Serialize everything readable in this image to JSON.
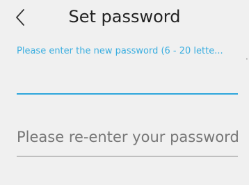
{
  "header": {
    "title": "Set password",
    "back_icon": "chevron-left-icon"
  },
  "new_password": {
    "hint": "Please enter the new password (6 - 20 lette...",
    "value": ""
  },
  "confirm_password": {
    "placeholder": "Please re-enter your password",
    "value": ""
  },
  "colors": {
    "accent": "#2ea6dc",
    "background": "#f0f0f0",
    "text": "#222222",
    "placeholder": "#777777"
  }
}
